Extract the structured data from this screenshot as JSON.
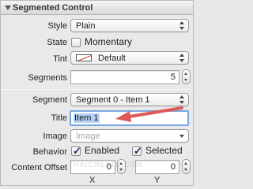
{
  "section": {
    "title": "Segmented Control"
  },
  "style": {
    "label": "Style",
    "value": "Plain"
  },
  "state": {
    "label": "State",
    "checkbox_label": "Momentary",
    "checked": false
  },
  "tint": {
    "label": "Tint",
    "value": "Default"
  },
  "segments": {
    "label": "Segments",
    "value": "5"
  },
  "segment": {
    "label": "Segment",
    "value": "Segment 0 - Item 1"
  },
  "title": {
    "label": "Title",
    "value": "Item 1"
  },
  "image": {
    "label": "Image",
    "placeholder": "Image"
  },
  "behavior": {
    "label": "Behavior",
    "enabled_label": "Enabled",
    "enabled": true,
    "selected_label": "Selected",
    "selected": true
  },
  "content_offset": {
    "label": "Content Offset",
    "x_value": "0",
    "y_value": "0",
    "x_label": "X",
    "y_label": "Y"
  },
  "watermark": "THAICREATE.COM",
  "colors": {
    "focus_ring": "#7aa7e0",
    "arrow": "#e05a5a",
    "selection": "#b5d3f7"
  }
}
